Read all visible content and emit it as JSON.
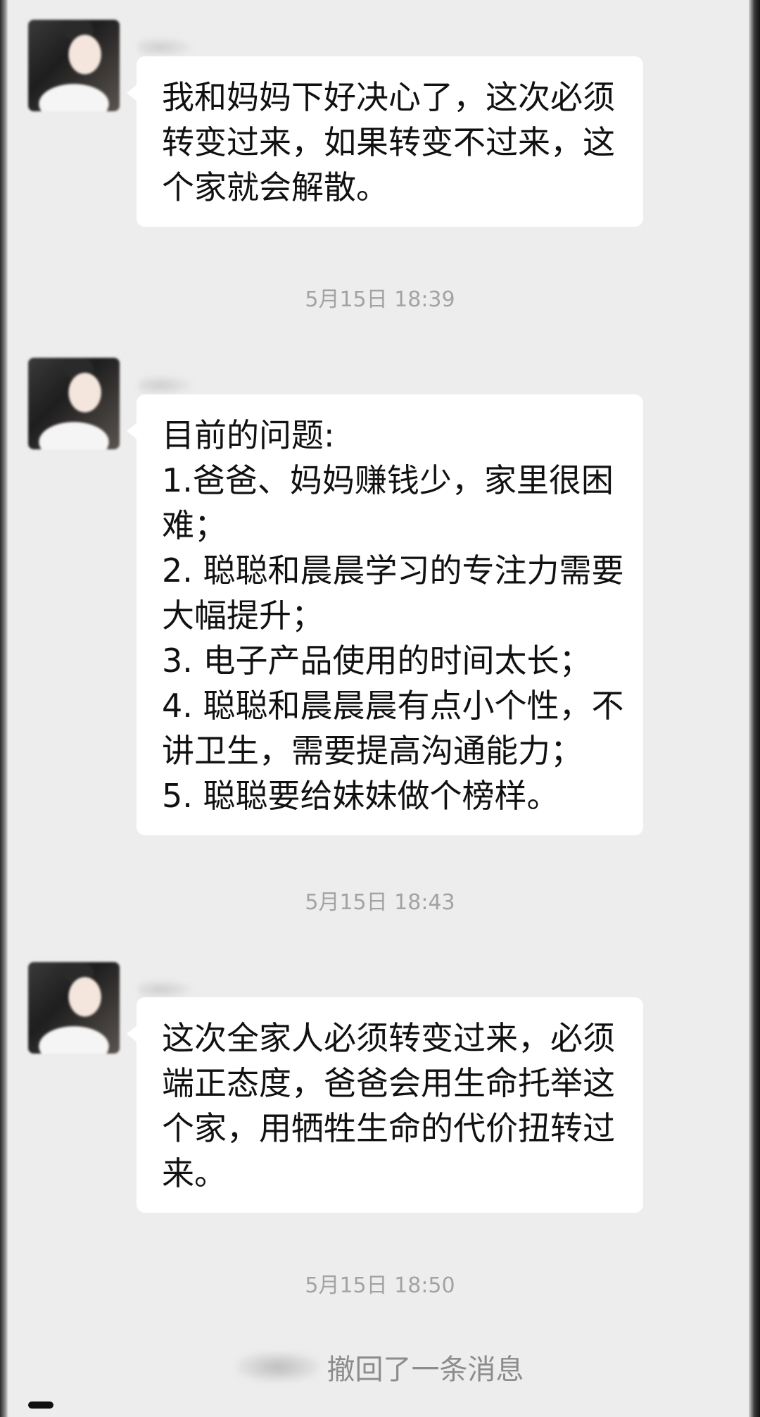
{
  "chat": {
    "messages": [
      {
        "lines": [
          "我和妈妈下好决心了，这次必须",
          "转变过来，如果转变不过来，这",
          "个家就会解散。"
        ]
      },
      {
        "lines": [
          "目前的问题:",
          "1.爸爸、妈妈赚钱少，家里很困",
          "难；",
          "2. 聪聪和晨晨学习的专注力需要",
          "大幅提升；",
          "3. 电子产品使用的时间太长；",
          "4. 聪聪和晨晨晨有点小个性，不",
          "讲卫生，需要提高沟通能力；",
          "5. 聪聪要给妹妹做个榜样。"
        ]
      },
      {
        "lines": [
          "这次全家人必须转变过来，必须",
          "端正态度，爸爸会用生命托举这",
          "个家，用牺牲生命的代价扭转过",
          "来。"
        ]
      }
    ],
    "timestamps": [
      "5月15日 18:39",
      "5月15日 18:43",
      "5月15日 18:50"
    ],
    "recall_notice": "撤回了一条消息"
  },
  "colors": {
    "background": "#ededed",
    "bubble": "#ffffff",
    "timestamp_text": "#a3a3a3",
    "message_text": "#111111"
  }
}
